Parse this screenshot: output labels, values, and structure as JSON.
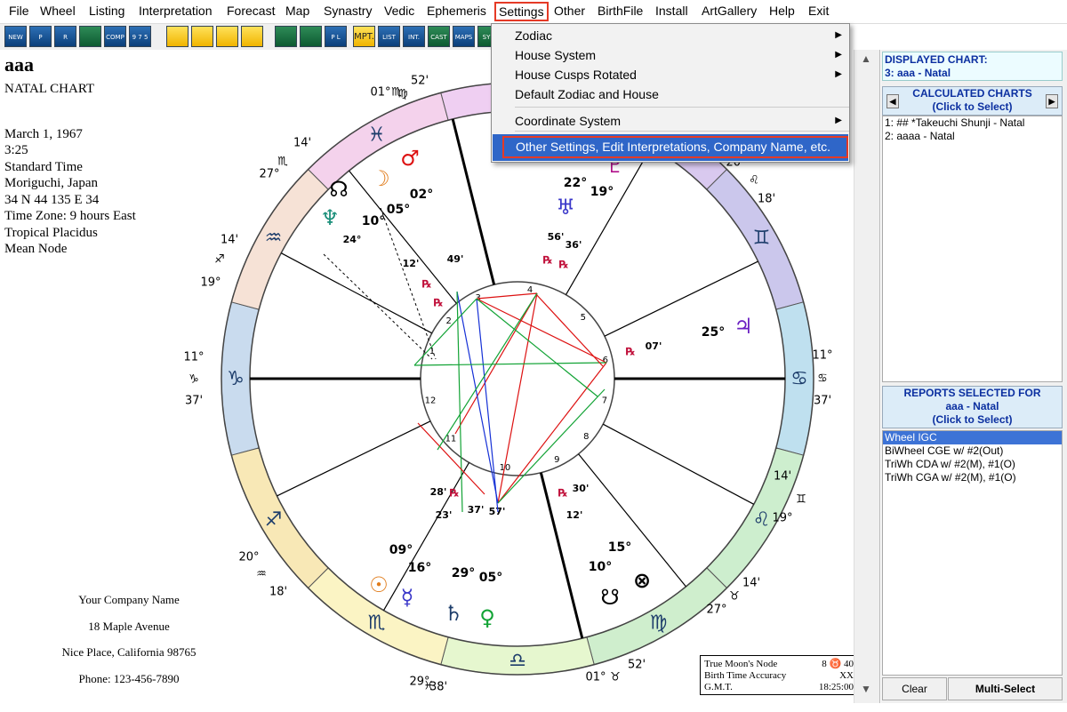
{
  "menu": [
    "File",
    "Wheel",
    "Listing",
    "Interpretation",
    "Forecast",
    "Map",
    "Synastry",
    "Vedic",
    "Ephemeris",
    "Settings",
    "Other",
    "BirthFile",
    "Install",
    "ArtGallery",
    "Help",
    "Exit"
  ],
  "toolbar_labels": [
    "NEW",
    "P",
    "R",
    "",
    "COMP",
    "9 7 5",
    "",
    "",
    "",
    "",
    "",
    "",
    "P L",
    "MPT.",
    "LIST",
    "INT.",
    "CAST",
    "MAPS",
    "SY"
  ],
  "dropdown": {
    "items": [
      "Zodiac",
      "House System",
      "House Cusps Rotated",
      "Default Zodiac and House",
      "Coordinate System"
    ],
    "selected": "Other Settings, Edit Interpretations, Company Name, etc."
  },
  "chart_info": {
    "name": "aaa",
    "type": "NATAL CHART",
    "date": "March 1, 1967",
    "time": "3:25",
    "time_type": "Standard Time",
    "place": "Moriguchi, Japan",
    "coords": "34 N 44    135 E 34",
    "tz": "Time Zone: 9 hours East",
    "system": "Tropical Placidus",
    "node": "Mean Node"
  },
  "company": {
    "name": "Your Company Name",
    "address": "18 Maple Avenue",
    "city": "Nice Place, California 98765",
    "phone": "Phone: 123-456-7890"
  },
  "node_box": {
    "l1": "True Moon's Node",
    "v1": "8 ♉ 40",
    "l2": "Birth Time Accuracy",
    "v2": "XX",
    "l3": "G.M.T.",
    "v3": "18:25:00"
  },
  "displayed": {
    "l1": "DISPLAYED CHART:",
    "l2": "3: aaa - Natal"
  },
  "calc": {
    "h1": "CALCULATED CHARTS",
    "h2": "(Click to Select)",
    "items": [
      "1: ## *Takeuchi Shunji - Natal",
      "2: aaaa - Natal"
    ]
  },
  "reports": {
    "h1": "REPORTS SELECTED FOR",
    "h2": "aaa - Natal",
    "h3": "(Click to Select)",
    "items": [
      "Wheel IGC",
      "BiWheel CGE w/ #2(Out)",
      "TriWh CDA w/ #2(M), #1(O)",
      "TriWh CGA w/ #2(M), #1(O)"
    ]
  },
  "buttons": {
    "clear": "Clear",
    "multi": "Multi-Select"
  },
  "wheel": {
    "cusp_degrees": [
      "01°",
      "52'",
      "14'",
      "27°",
      "14'",
      "19°",
      "11°",
      "37'",
      "20°",
      "18'",
      "29°",
      "38'",
      "01°",
      "52'",
      "27°",
      "14'",
      "14'",
      "19°",
      "11°",
      "37'",
      "20°",
      "18'",
      "29°",
      "38'"
    ],
    "house_numbers": [
      "1",
      "2",
      "3",
      "4",
      "5",
      "6",
      "7",
      "8",
      "9",
      "10",
      "11",
      "12"
    ],
    "signs": [
      "♈",
      "♉",
      "♊",
      "♋",
      "♌",
      "♍",
      "♎",
      "♏",
      "♐",
      "♑",
      "♒",
      "♓"
    ],
    "cusp_signs": [
      "♏",
      "♏",
      "♐",
      "♑",
      "♒",
      "♓",
      "♉",
      "♉",
      "♊",
      "♋",
      "♌",
      "♍"
    ],
    "planets": [
      {
        "g": "☊",
        "d": "",
        "m": ""
      },
      {
        "g": "☽",
        "d": "10°",
        "m": "24°"
      },
      {
        "g": "♂",
        "d": "02°",
        "m": "49'"
      },
      {
        "g": "♆",
        "d": "05°",
        "m": "12'"
      },
      {
        "g": "♃",
        "d": "25°",
        "m": "07'"
      },
      {
        "g": "♄",
        "d": "29°",
        "m": "37'"
      },
      {
        "g": "♀",
        "d": "05°",
        "m": "57'"
      },
      {
        "g": "☉",
        "d": "09°",
        "m": "23'"
      },
      {
        "g": "☿",
        "d": "16°",
        "m": "28'"
      },
      {
        "g": "☋",
        "d": "15°",
        "m": "12'"
      },
      {
        "g": "⊗",
        "d": "10°",
        "m": "30'"
      },
      {
        "g": "♇",
        "d": "22°",
        "m": "56'"
      },
      {
        "g": "♅",
        "d": "19°",
        "m": "36'"
      }
    ],
    "retro": [
      "℞",
      "℞",
      "℞",
      "℞",
      "℞",
      "℞",
      "℞"
    ]
  }
}
